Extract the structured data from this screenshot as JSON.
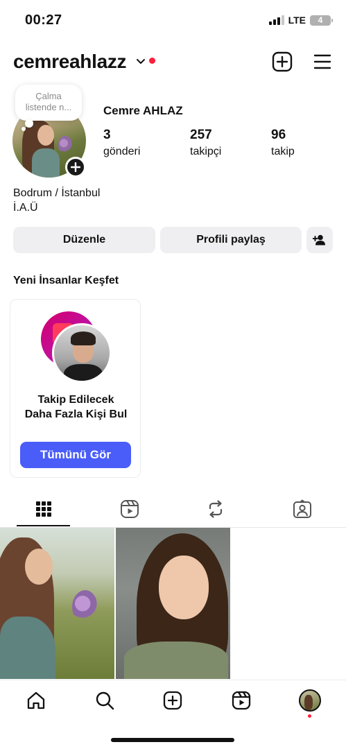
{
  "status_bar": {
    "time": "00:27",
    "network": "LTE",
    "battery": "4"
  },
  "header": {
    "username": "cemreahlazz"
  },
  "profile": {
    "note": "Çalma listende n...",
    "full_name": "Cemre AHLAZ",
    "stats": [
      {
        "value": "3",
        "label": "gönderi"
      },
      {
        "value": "257",
        "label": "takipçi"
      },
      {
        "value": "96",
        "label": "takip"
      }
    ],
    "bio": [
      "Bodrum / İstanbul",
      "İ.A.Ü"
    ]
  },
  "actions": {
    "edit": "Düzenle",
    "share": "Profili paylaş"
  },
  "discover": {
    "title": "Yeni İnsanlar Keşfet",
    "card_text": [
      "Takip Edilecek",
      "Daha Fazla Kişi Bul"
    ],
    "card_button": "Tümünü Gör"
  },
  "tabs": [
    "grid-icon",
    "reels-icon",
    "reposts-icon",
    "tagged-icon"
  ],
  "nav": [
    "home-icon",
    "search-icon",
    "create-icon",
    "reels-icon",
    "profile-avatar"
  ],
  "colors": {
    "accent": "#4a5df9",
    "notification": "#ff1f3d",
    "button_bg": "#efeff1"
  }
}
